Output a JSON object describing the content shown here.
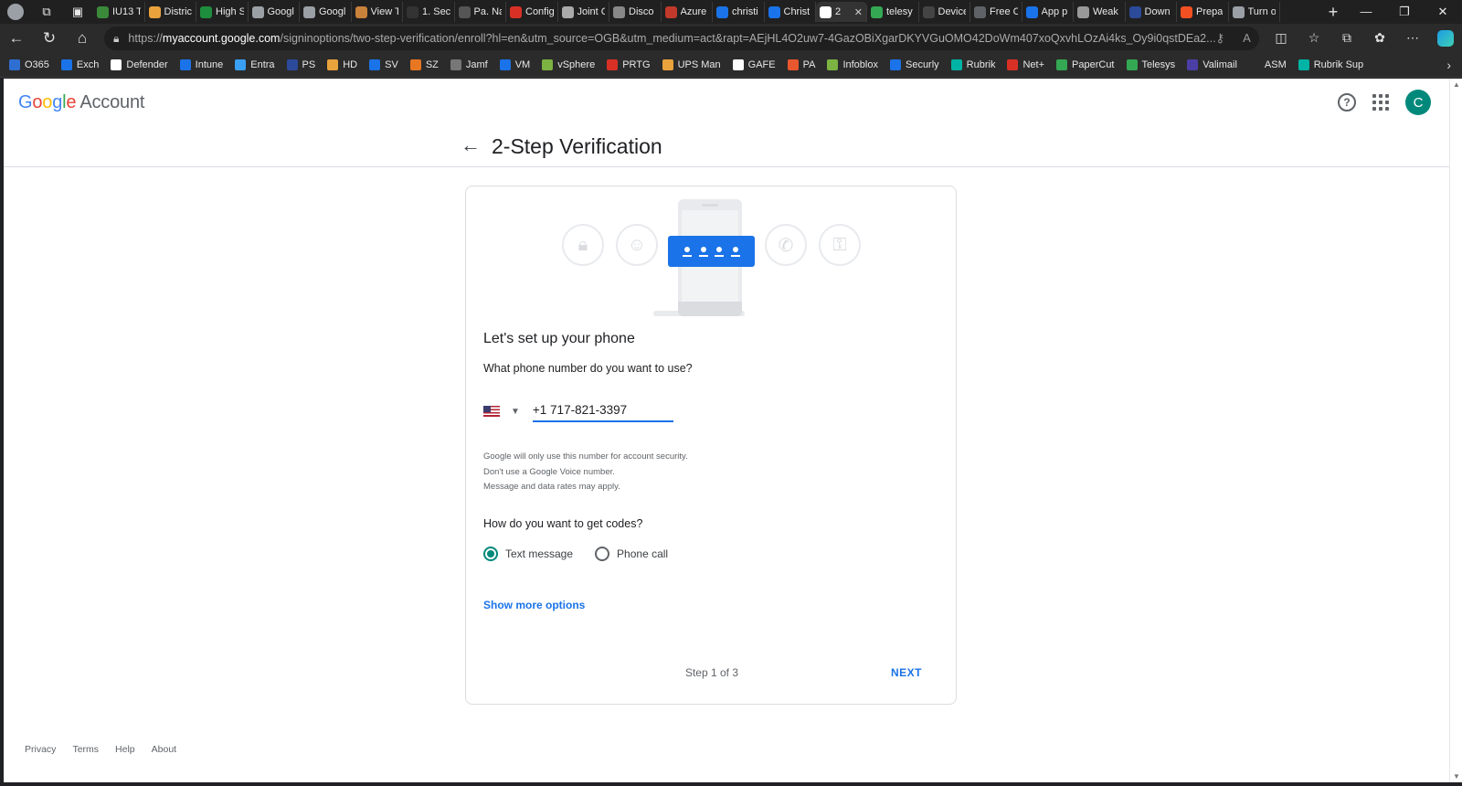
{
  "browser": {
    "tabs": [
      {
        "title": "IU13 T",
        "color": "#3a8a3a"
      },
      {
        "title": "Distric",
        "color": "#e8a33d"
      },
      {
        "title": "High S",
        "color": "#1e8e3e"
      },
      {
        "title": "Googl",
        "color": "#9aa0a6"
      },
      {
        "title": "Googl",
        "color": "#9aa0a6"
      },
      {
        "title": "View T",
        "color": "#c9823b"
      },
      {
        "title": "1. Sec",
        "color": "#333333"
      },
      {
        "title": "Pa. Na",
        "color": "#555555"
      },
      {
        "title": "Config",
        "color": "#d93025"
      },
      {
        "title": "Joint C",
        "color": "#aaaaaa"
      },
      {
        "title": "Disco",
        "color": "#888888"
      },
      {
        "title": "Azure",
        "color": "#c0392b"
      },
      {
        "title": "christi",
        "color": "#1a73e8"
      },
      {
        "title": "Christ",
        "color": "#1a73e8"
      },
      {
        "title": "2",
        "color": "#ffffff",
        "active": true
      },
      {
        "title": "telesy",
        "color": "#34a853"
      },
      {
        "title": "Device",
        "color": "#444444"
      },
      {
        "title": "Free C",
        "color": "#5f6368"
      },
      {
        "title": "App p",
        "color": "#1a73e8"
      },
      {
        "title": "Weak",
        "color": "#999999"
      },
      {
        "title": "Down",
        "color": "#2b4a9a"
      },
      {
        "title": "Prepa",
        "color": "#f25022"
      },
      {
        "title": "Turn o",
        "color": "#9aa0a6"
      }
    ],
    "url_prefix": "https://",
    "url_host": "myaccount.google.com",
    "url_path": "/signinoptions/two-step-verification/enroll?hl=en&utm_source=OGB&utm_medium=act&rapt=AEjHL4O2uw7-4GazOBiXgarDKYVGuOMO42DoWm407xoQxvhLOzAi4ks_Oy9i0qstDEa2...",
    "bookmarks": [
      {
        "label": "O365",
        "color": "#2f6fd1"
      },
      {
        "label": "Exch",
        "color": "#1a73e8"
      },
      {
        "label": "Defender",
        "color": "#ffffff"
      },
      {
        "label": "Intune",
        "color": "#1a73e8"
      },
      {
        "label": "Entra",
        "color": "#3aa0f5"
      },
      {
        "label": "PS",
        "color": "#2b4a9a"
      },
      {
        "label": "HD",
        "color": "#e8a33d"
      },
      {
        "label": "SV",
        "color": "#1a73e8"
      },
      {
        "label": "SZ",
        "color": "#e87722"
      },
      {
        "label": "Jamf",
        "color": "#777777"
      },
      {
        "label": "VM",
        "color": "#1a73e8"
      },
      {
        "label": "vSphere",
        "color": "#7cb342"
      },
      {
        "label": "PRTG",
        "color": "#d93025"
      },
      {
        "label": "UPS Man",
        "color": "#e8a33d"
      },
      {
        "label": "GAFE",
        "color": "#ffffff"
      },
      {
        "label": "PA",
        "color": "#e8572d"
      },
      {
        "label": "Infoblox",
        "color": "#7cb342"
      },
      {
        "label": "Securly",
        "color": "#1a73e8"
      },
      {
        "label": "Rubrik",
        "color": "#00b3a4"
      },
      {
        "label": "Net+",
        "color": "#d93025"
      },
      {
        "label": "PaperCut",
        "color": "#34a853"
      },
      {
        "label": "Telesys",
        "color": "#34a853"
      },
      {
        "label": "Valimail",
        "color": "#4b3fa6"
      },
      {
        "label": "ASM",
        "color": "#2b2b2b"
      },
      {
        "label": "Rubrik Sup",
        "color": "#00b3a4"
      }
    ]
  },
  "header": {
    "logo": {
      "g": "G",
      "o1": "o",
      "o2": "o",
      "g2": "g",
      "l": "l",
      "e": "e",
      "product": "Account"
    },
    "avatar_letter": "C",
    "help_glyph": "?"
  },
  "title": {
    "back_arrow": "←",
    "text": "2-Step Verification"
  },
  "card": {
    "heading": "Let's set up your phone",
    "phone_question": "What phone number do you want to use?",
    "country": "US",
    "phone_value": "+1 717-821-3397",
    "disclaimer": [
      "Google will only use this number for account security.",
      "Don't use a Google Voice number.",
      "Message and data rates may apply."
    ],
    "codes_question": "How do you want to get codes?",
    "options": [
      {
        "label": "Text message",
        "selected": true
      },
      {
        "label": "Phone call",
        "selected": false
      }
    ],
    "more_options": "Show more options",
    "step": "Step 1 of 3",
    "next": "NEXT"
  },
  "footer": {
    "links": [
      "Privacy",
      "Terms",
      "Help",
      "About"
    ]
  },
  "colors": {
    "accent": "#1a73e8",
    "radio_selected": "#00897b",
    "avatar": "#00897b"
  }
}
